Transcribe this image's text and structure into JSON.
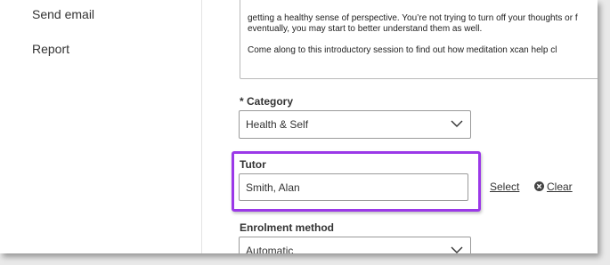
{
  "sidebar": {
    "items": [
      {
        "label": "Send email"
      },
      {
        "label": "Report"
      }
    ]
  },
  "description": {
    "line1": "getting a healthy sense of perspective. You’re not trying to turn off your thoughts or f",
    "line2": "eventually, you may start to better understand them as well.",
    "line3": "Come along to this introductory session to find out how meditation xcan help cl"
  },
  "category": {
    "label": "* Category",
    "value": "Health & Self"
  },
  "tutor": {
    "label": "Tutor",
    "value": "Smith, Alan",
    "select_label": "Select",
    "clear_label": "Clear"
  },
  "enrolment": {
    "label": "Enrolment method",
    "value": "Automatic"
  },
  "colors": {
    "highlight": "#9b39e8"
  }
}
